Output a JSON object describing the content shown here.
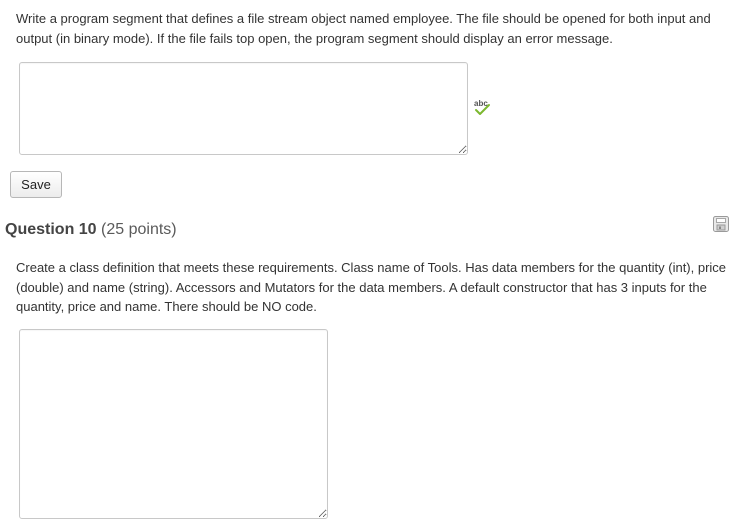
{
  "question9": {
    "prompt": "Write a program segment that defines a file stream object named employee. The file should be opened for both input and output (in binary mode). If the file fails top open, the program segment should display an error message.",
    "answer_value": "",
    "spellcheck_icon": "spellcheck-abc-icon",
    "save_label": "Save"
  },
  "question10": {
    "title": "Question 10",
    "points": "(25 points)",
    "save_state_icon": "floppy-disk-icon",
    "prompt": "Create a class definition that meets these requirements. Class name of Tools. Has data members for the quantity (int), price (double) and name (string). Accessors and Mutators for the data members. A default constructor that has 3 inputs for the quantity, price and name. There should be NO code.",
    "answer_value": ""
  }
}
